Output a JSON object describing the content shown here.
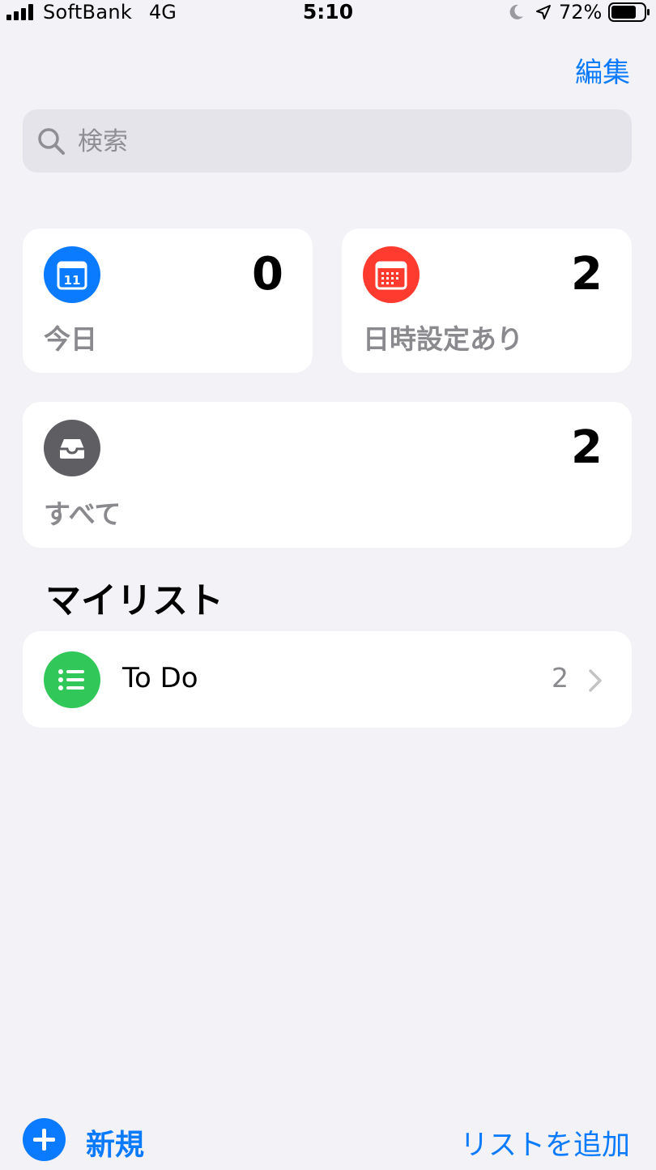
{
  "status_bar": {
    "carrier": "SoftBank",
    "network": "4G",
    "time": "5:10",
    "battery": "72%"
  },
  "header": {
    "edit_label": "編集"
  },
  "search": {
    "placeholder": "検索",
    "value": ""
  },
  "smart_lists": {
    "today": {
      "label": "今日",
      "count": "0",
      "icon": "calendar-icon",
      "color": "#0A7AFF",
      "icon_day": "11"
    },
    "scheduled": {
      "label": "日時設定あり",
      "count": "2",
      "icon": "calendar-grid-icon",
      "color": "#FF3B30"
    },
    "all": {
      "label": "すべて",
      "count": "2",
      "icon": "tray-icon",
      "color": "#5E5E63"
    }
  },
  "my_lists": {
    "title": "マイリスト",
    "items": [
      {
        "name": "To Do",
        "count": "2",
        "icon": "list-bullet-icon",
        "color": "#31C759"
      }
    ]
  },
  "toolbar": {
    "new_label": "新規",
    "add_list_label": "リストを追加"
  },
  "colors": {
    "accent": "#0A7AFF",
    "background": "#F2F2F7"
  }
}
